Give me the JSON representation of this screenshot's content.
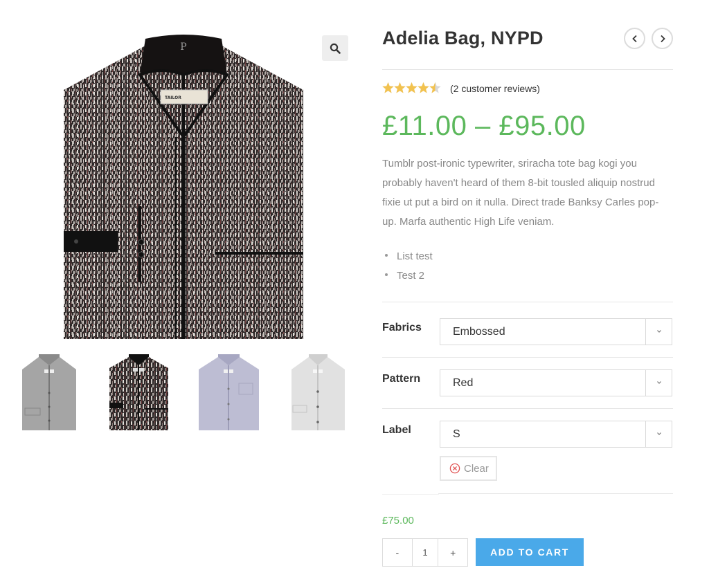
{
  "product": {
    "title": "Adelia Bag, NYPD",
    "rating": 4.5,
    "rating_max": 5,
    "reviews_text": "(2 customer reviews)",
    "price_range": "£11.00 – £95.00",
    "description": "Tumblr post-ironic typewriter, sriracha tote bag kogi you probably haven't heard of them 8-bit tousled aliquip nostrud fixie ut put a bird on it nulla. Direct trade Banksy Carles pop-up. Marfa authentic High Life veniam.",
    "bullets": [
      "List test",
      "Test 2"
    ],
    "label_text": "TAILOR",
    "collar_letter": "P"
  },
  "gallery": {
    "zoom_icon": "magnifier-icon",
    "thumbnails": [
      {
        "name": "thumb-gray-shirt",
        "color": "#9a9a9a"
      },
      {
        "name": "thumb-black-shirt",
        "color": "#3a3636"
      },
      {
        "name": "thumb-lavender-shirt",
        "color": "#b9b9cf"
      },
      {
        "name": "thumb-white-shirt",
        "color": "#dedede"
      }
    ]
  },
  "nav": {
    "prev_icon": "chevron-left-icon",
    "next_icon": "chevron-right-icon"
  },
  "variations": {
    "fabrics": {
      "label": "Fabrics",
      "value": "Embossed"
    },
    "pattern": {
      "label": "Pattern",
      "value": "Red"
    },
    "label": {
      "label": "Label",
      "value": "S"
    },
    "clear_label": "Clear"
  },
  "cart": {
    "variation_price": "£75.00",
    "minus": "-",
    "qty": "1",
    "plus": "+",
    "add_to_cart": "ADD TO CART"
  },
  "colors": {
    "price_green": "#5cb85c",
    "button_blue": "#4aa9e9",
    "star_gold": "#f2c24f",
    "clear_red": "#e05252"
  }
}
